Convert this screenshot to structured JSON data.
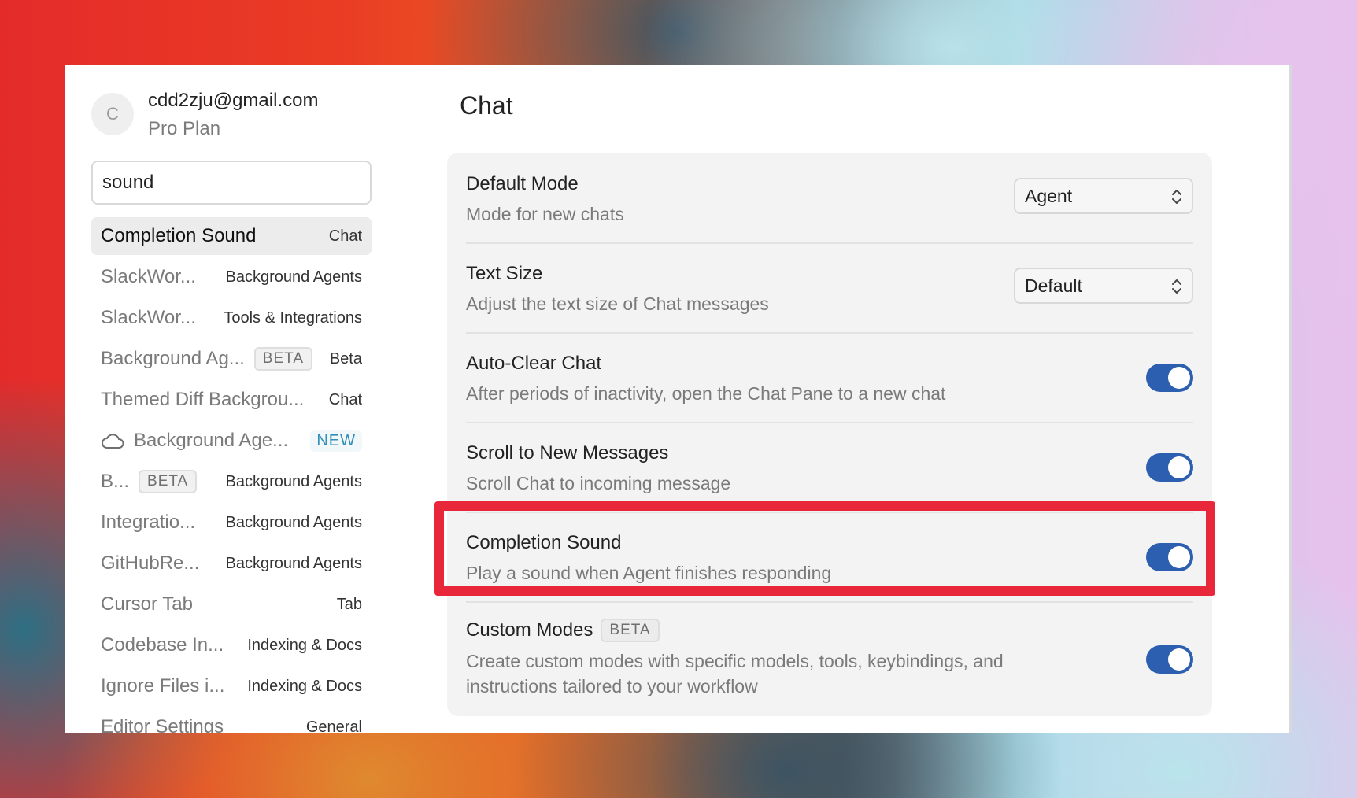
{
  "account": {
    "avatar_initial": "C",
    "email": "cdd2zju@gmail.com",
    "plan": "Pro Plan"
  },
  "search": {
    "value": "sound"
  },
  "results": [
    {
      "label": "Completion Sound",
      "badge": "",
      "category": "Chat",
      "active": true
    },
    {
      "label": "SlackWor...",
      "badge": "",
      "category": "Background Agents"
    },
    {
      "label": "SlackWor...",
      "badge": "",
      "category": "Tools & Integrations"
    },
    {
      "label": "Background Ag...",
      "badge": "BETA",
      "category": "Beta"
    },
    {
      "label": "Themed Diff Backgrou...",
      "badge": "",
      "category": "Chat"
    },
    {
      "label": "Background Age...",
      "icon": "cloud-icon",
      "new_badge": "NEW"
    },
    {
      "label": "B...",
      "badge": "BETA",
      "category": "Background Agents"
    },
    {
      "label": "Integratio...",
      "badge": "",
      "category": "Background Agents"
    },
    {
      "label": "GitHubRe...",
      "badge": "",
      "category": "Background Agents"
    },
    {
      "label": "Cursor Tab",
      "badge": "",
      "category": "Tab"
    },
    {
      "label": "Codebase In...",
      "badge": "",
      "category": "Indexing & Docs"
    },
    {
      "label": "Ignore Files i...",
      "badge": "",
      "category": "Indexing & Docs"
    },
    {
      "label": "Editor Settings",
      "badge": "",
      "category": "General"
    }
  ],
  "main": {
    "title": "Chat",
    "settings": {
      "default_mode": {
        "title": "Default Mode",
        "desc": "Mode for new chats",
        "value": "Agent"
      },
      "text_size": {
        "title": "Text Size",
        "desc": "Adjust the text size of Chat messages",
        "value": "Default"
      },
      "auto_clear": {
        "title": "Auto-Clear Chat",
        "desc": "After periods of inactivity, open the Chat Pane to a new chat",
        "enabled": true
      },
      "scroll_new": {
        "title": "Scroll to New Messages",
        "desc": "Scroll Chat to incoming message",
        "enabled": true
      },
      "completion_sound": {
        "title": "Completion Sound",
        "desc": "Play a sound when Agent finishes responding",
        "enabled": true
      },
      "custom_modes": {
        "title": "Custom Modes",
        "badge": "BETA",
        "desc": "Create custom modes with specific models, tools, keybindings, and instructions tailored to your workflow",
        "enabled": true
      }
    }
  },
  "colors": {
    "toggle_on": "#2c5fb0",
    "highlight": "#e8273b",
    "new_badge": "#2f8fb8"
  }
}
